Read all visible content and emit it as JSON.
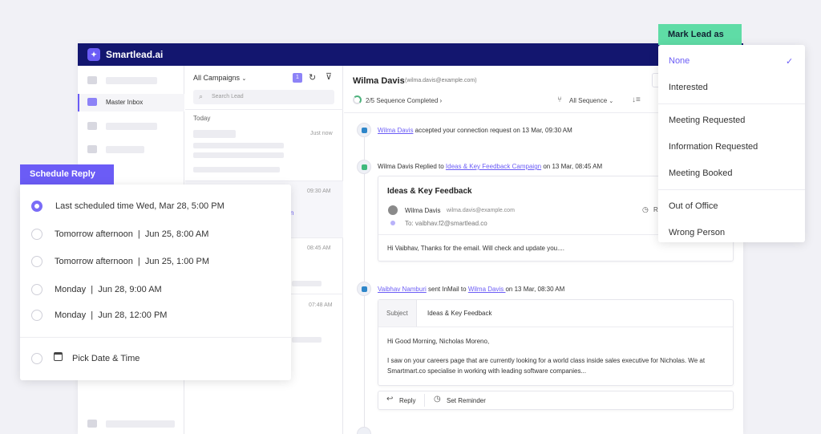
{
  "app": {
    "brand": "Smartlead.ai",
    "logo_glyph": "✦"
  },
  "sidebar": {
    "active_item": "Master Inbox"
  },
  "list": {
    "campaign_filter": "All Campaigns",
    "badge_count": "1",
    "search_placeholder": "Search Lead",
    "group_label": "Today",
    "items": [
      {
        "time": "Just now"
      },
      {
        "time": "09:30 AM",
        "fragment": "n"
      },
      {
        "time": "08:45 AM"
      },
      {
        "time": "07:48 AM"
      }
    ]
  },
  "header": {
    "name": "Wilma Davis",
    "email": "(wilma.davis@example.com)",
    "sequence": "2/5 Sequence Completed",
    "sequence_filter": "All Sequence"
  },
  "events": {
    "e1": {
      "actor": "Wilma Davis",
      "text": " accepted your connection request on 13 Mar, 09:30 AM"
    },
    "e2": {
      "prefix": "Wilma Davis Replied to ",
      "link": "Ideas & Key Feedback Campaign",
      "suffix": " on 13 Mar, 08:45 AM"
    },
    "e3": {
      "actor": "Vaibhav Namburi",
      "middle": " sent InMail to ",
      "target": "Wilma Davis ",
      "suffix": "on 13 Mar, 08:30 AM"
    }
  },
  "card1": {
    "title": "Ideas & Key Feedback",
    "from_name": "Wilma Davis",
    "from_email": "wilma.davis@example.com",
    "to_line": "To: vaibhav.f2@smartlead.co",
    "reply_fragment": "R",
    "body": "Hi Vaibhav, Thanks for the email. Will check and update you...."
  },
  "card2": {
    "subject_label": "Subject",
    "subject": "Ideas & Key Feedback",
    "greeting": "Hi Good Morning, Nicholas Moreno,",
    "body_line1": "I saw on your careers page that are currently looking for a world class inside sales executive for Nicholas. We at",
    "body_line2": "Smartmart.co specialise in working with leading software companies...",
    "reply_label": "Reply",
    "reminder_label": "Set Reminder"
  },
  "schedule": {
    "title": "Schedule Reply",
    "options": [
      "Last scheduled time Wed, Mar 28, 5:00 PM",
      "Tomorrow afternoon  |  Jun 25, 8:00 AM",
      "Tomorrow afternoon  |  Jun 25, 1:00 PM",
      "Monday  |  Jun 28, 9:00 AM",
      "Monday  |  Jun 28, 12:00 PM"
    ],
    "selected_index": 0,
    "pick_label": "Pick Date & Time"
  },
  "mark_lead": {
    "title": "Mark Lead as",
    "options": [
      "None",
      "Interested",
      "Meeting Requested",
      "Information Requested",
      "Meeting Booked",
      "Out of Office",
      "Wrong Person"
    ],
    "selected": "None",
    "check_glyph": "✓"
  },
  "colors": {
    "accent": "#6b5cf6",
    "topbar": "#13166f",
    "mark_head": "#5fdca6"
  }
}
